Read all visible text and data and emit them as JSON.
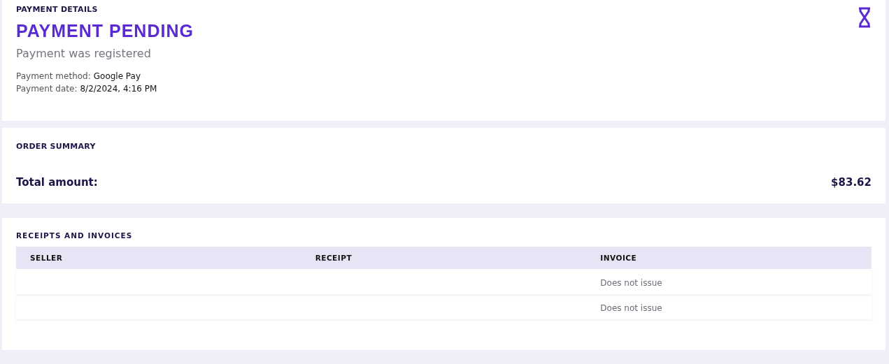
{
  "payment_details": {
    "heading": "PAYMENT DETAILS",
    "status": "PAYMENT PENDING",
    "message": "Payment was registered",
    "fields": [
      {
        "label": "Payment method:",
        "value": "Google Pay"
      },
      {
        "label": "Payment date:",
        "value": "8/2/2024, 4:16 PM"
      }
    ]
  },
  "order_summary": {
    "heading": "ORDER SUMMARY",
    "total_label": "Total amount:",
    "total_value": "$83.62"
  },
  "receipts": {
    "heading": "RECEIPTS AND INVOICES",
    "columns": [
      "SELLER",
      "RECEIPT",
      "INVOICE"
    ],
    "rows": [
      {
        "invoice": "Does not issue"
      },
      {
        "invoice": "Does not issue"
      }
    ]
  }
}
